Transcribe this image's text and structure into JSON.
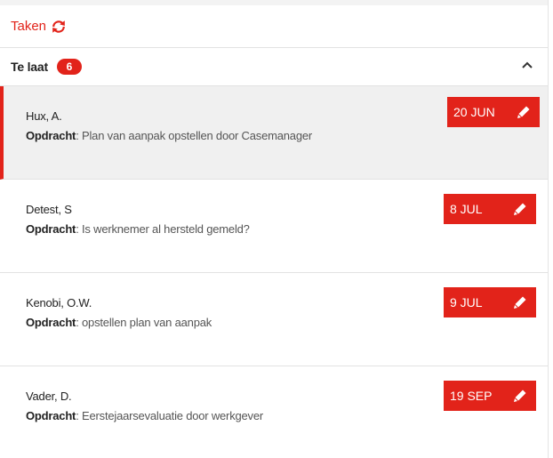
{
  "header": {
    "title": "Taken",
    "refresh_icon": "refresh-icon"
  },
  "section": {
    "label": "Te laat",
    "count": "6",
    "toggle_icon": "chevron-up-icon"
  },
  "tasks": [
    {
      "name": "Hux, A.",
      "field": "Opdracht",
      "text": ": Plan van aanpak opstellen door Casemanager",
      "date": "20 JUN",
      "active": true
    },
    {
      "name": "Detest, S",
      "field": "Opdracht",
      "text": ": Is werknemer al hersteld gemeld?",
      "date": "8 JUL",
      "active": false
    },
    {
      "name": "Kenobi, O.W.",
      "field": "Opdracht",
      "text": ": opstellen plan van aanpak",
      "date": "9 JUL",
      "active": false
    },
    {
      "name": "Vader, D.",
      "field": "Opdracht",
      "text": ": Eerstejaarsevaluatie door werkgever",
      "date": "19 SEP",
      "active": false
    }
  ],
  "colors": {
    "accent": "#e2231a",
    "active_row": "#f0f0f0",
    "divider": "#e2e2e2"
  }
}
